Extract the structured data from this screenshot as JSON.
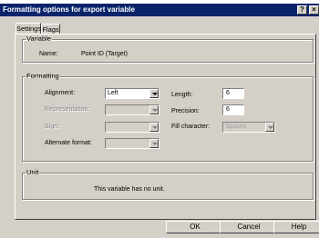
{
  "window": {
    "title": "Formatting options for export variable",
    "help_glyph": "?",
    "close_glyph": "×"
  },
  "tabs": [
    {
      "label": "Settings"
    },
    {
      "label": "Flags"
    }
  ],
  "variable_group": {
    "legend": "Variable",
    "name_label": "Name:",
    "name_value": "Point ID (Target)"
  },
  "formatting_group": {
    "legend": "Formatting",
    "alignment": {
      "label": "Alignment:",
      "value": "Left"
    },
    "representation": {
      "label": "Representation:",
      "value": ""
    },
    "sign": {
      "label": "Sign:",
      "value": ""
    },
    "alternate_format": {
      "label": "Alternate format:",
      "value": ""
    },
    "length": {
      "label": "Length:",
      "value": "6"
    },
    "precision": {
      "label": "Precision:",
      "value": "6"
    },
    "fill_character": {
      "label": "Fill character:",
      "value": "Spaces"
    }
  },
  "unit_group": {
    "legend": "Unit",
    "message": "This variable has no unit."
  },
  "buttons": {
    "ok": "OK",
    "cancel": "Cancel",
    "help": "Help"
  }
}
